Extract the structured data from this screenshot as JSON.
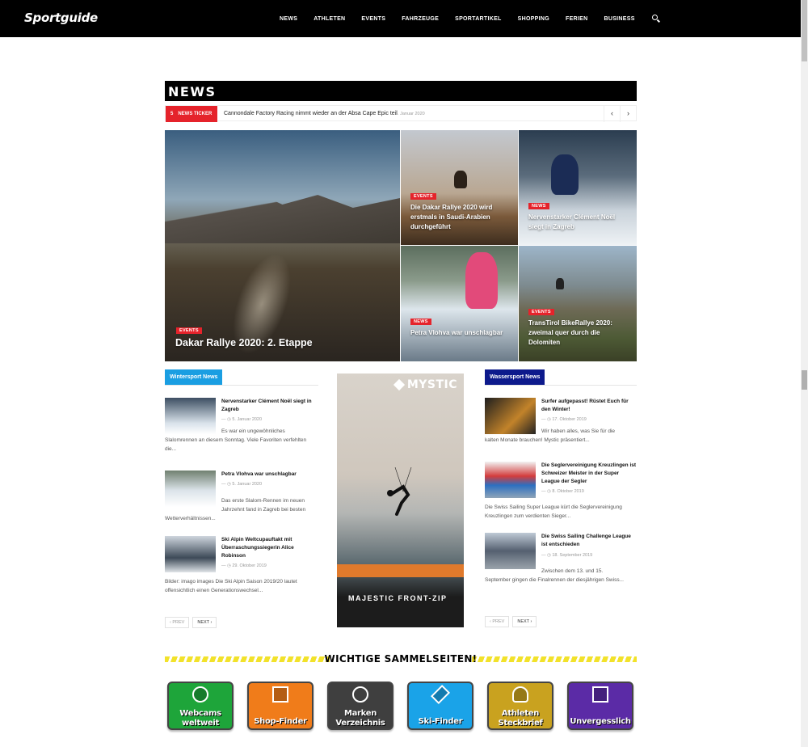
{
  "site": {
    "logo": "Sportguide"
  },
  "nav": {
    "items": [
      "NEWS",
      "ATHLETEN",
      "EVENTS",
      "FAHRZEUGE",
      "SPORTARTIKEL",
      "SHOPPING",
      "FERIEN",
      "BUSINESS"
    ],
    "search_icon": "search-icon"
  },
  "section": {
    "title": "NEWS"
  },
  "ticker": {
    "badge": "NEWS TICKER",
    "badge_mark": "5",
    "headline": "Cannondale Factory Racing nimmt wieder an der Absa Cape Epic teil",
    "date": "6. Januar 2020",
    "prev": "‹",
    "next": "›"
  },
  "hero": [
    {
      "category": "EVENTS",
      "title": "Dakar Rallye 2020: 2. Etappe"
    },
    {
      "category": "EVENTS",
      "title": "Die Dakar Rallye 2020 wird erstmals in Saudi-Arabien durchgeführt"
    },
    {
      "category": "NEWS",
      "title": "Nervenstarker Clément Noël siegt in Zagreb"
    },
    {
      "category": "NEWS",
      "title": "Petra Vlohva war unschlagbar"
    },
    {
      "category": "EVENTS",
      "title": "TransTirol BikeRallye 2020: zweimal quer durch die Dolomiten"
    }
  ],
  "winter": {
    "heading": "Wintersport News",
    "color": "#1a9ee2",
    "posts": [
      {
        "title": "Nervenstarker Clément Noël siegt in Zagreb",
        "date": "— ◷ 5. Januar 2020",
        "excerpt_a": "Es war ein ungewöhnliches",
        "excerpt_b": "Slalomrennen an diesem Sonntag. Viele Favoriten verfehlten die..."
      },
      {
        "title": "Petra Vlohva war unschlagbar",
        "date": "— ◷ 5. Januar 2020",
        "excerpt_a": "Das erste Slalom-Rennen im neuen Jahrzehnt fand in Zagreb bei besten",
        "excerpt_b": "Wetterverhältnissen..."
      },
      {
        "title": "Ski Alpin Weltcupauftakt mit Überraschungssiegerin Alice Robinson",
        "date": "— ◷ 29. Oktober 2019",
        "excerpt_a": "",
        "excerpt_b": "Bilder: imago images Die Ski Alpin Saison 2019/20 lautet offensichtlich einen Generationswechsel..."
      }
    ],
    "prev": "‹ PREV",
    "next": "NEXT ›"
  },
  "ad": {
    "brand": "MYSTIC",
    "tagline": "MAJESTIC FRONT-ZIP"
  },
  "wasser": {
    "heading": "Wassersport News",
    "color": "#0d1a8c",
    "posts": [
      {
        "title": "Surfer aufgepasst! Rüstet Euch für den Winter!",
        "date": "— ◷ 17. Oktober 2019",
        "excerpt_a": "Wir haben alles, was Sie für die",
        "excerpt_b": "kalten Monate brauchen! Mystic präsentiert..."
      },
      {
        "title": "Die Seglervereinigung Kreuzlingen ist Schweizer Meister in der Super League der Segler",
        "date": "— ◷ 8. Oktober 2019",
        "excerpt_a": "",
        "excerpt_b": "Die Swiss Sailing Super League kürt die Seglervereinigung Kreuzlingen zum verdienten Sieger..."
      },
      {
        "title": "Die Swiss Sailing Challenge League ist entschieden",
        "date": "— ◷ 18. September 2019",
        "excerpt_a": "Zwischen dem 13. und 15.",
        "excerpt_b": "September gingen die Finalrennen der diesjährigen Swiss..."
      }
    ],
    "prev": "‹ PREV",
    "next": "NEXT ›"
  },
  "sammel": {
    "title": "WICHTIGE SAMMELSEITEN!",
    "tiles": [
      {
        "label": "Webcams weltweit",
        "color": "#1ea53a",
        "icon": "webcam-icon"
      },
      {
        "label": "Shop-Finder",
        "color": "#f07c1a",
        "icon": "shop-icon"
      },
      {
        "label": "Marken Verzeichnis",
        "color": "#3f3f3f",
        "icon": "registered-icon"
      },
      {
        "label": "Ski-Finder",
        "color": "#1aa3e8",
        "icon": "ski-icon"
      },
      {
        "label": "Athleten Steckbrief",
        "color": "#c9a21f",
        "icon": "athlete-icon"
      },
      {
        "label": "Unvergesslich",
        "color": "#5b2ba6",
        "icon": "gallery-icon"
      }
    ]
  }
}
